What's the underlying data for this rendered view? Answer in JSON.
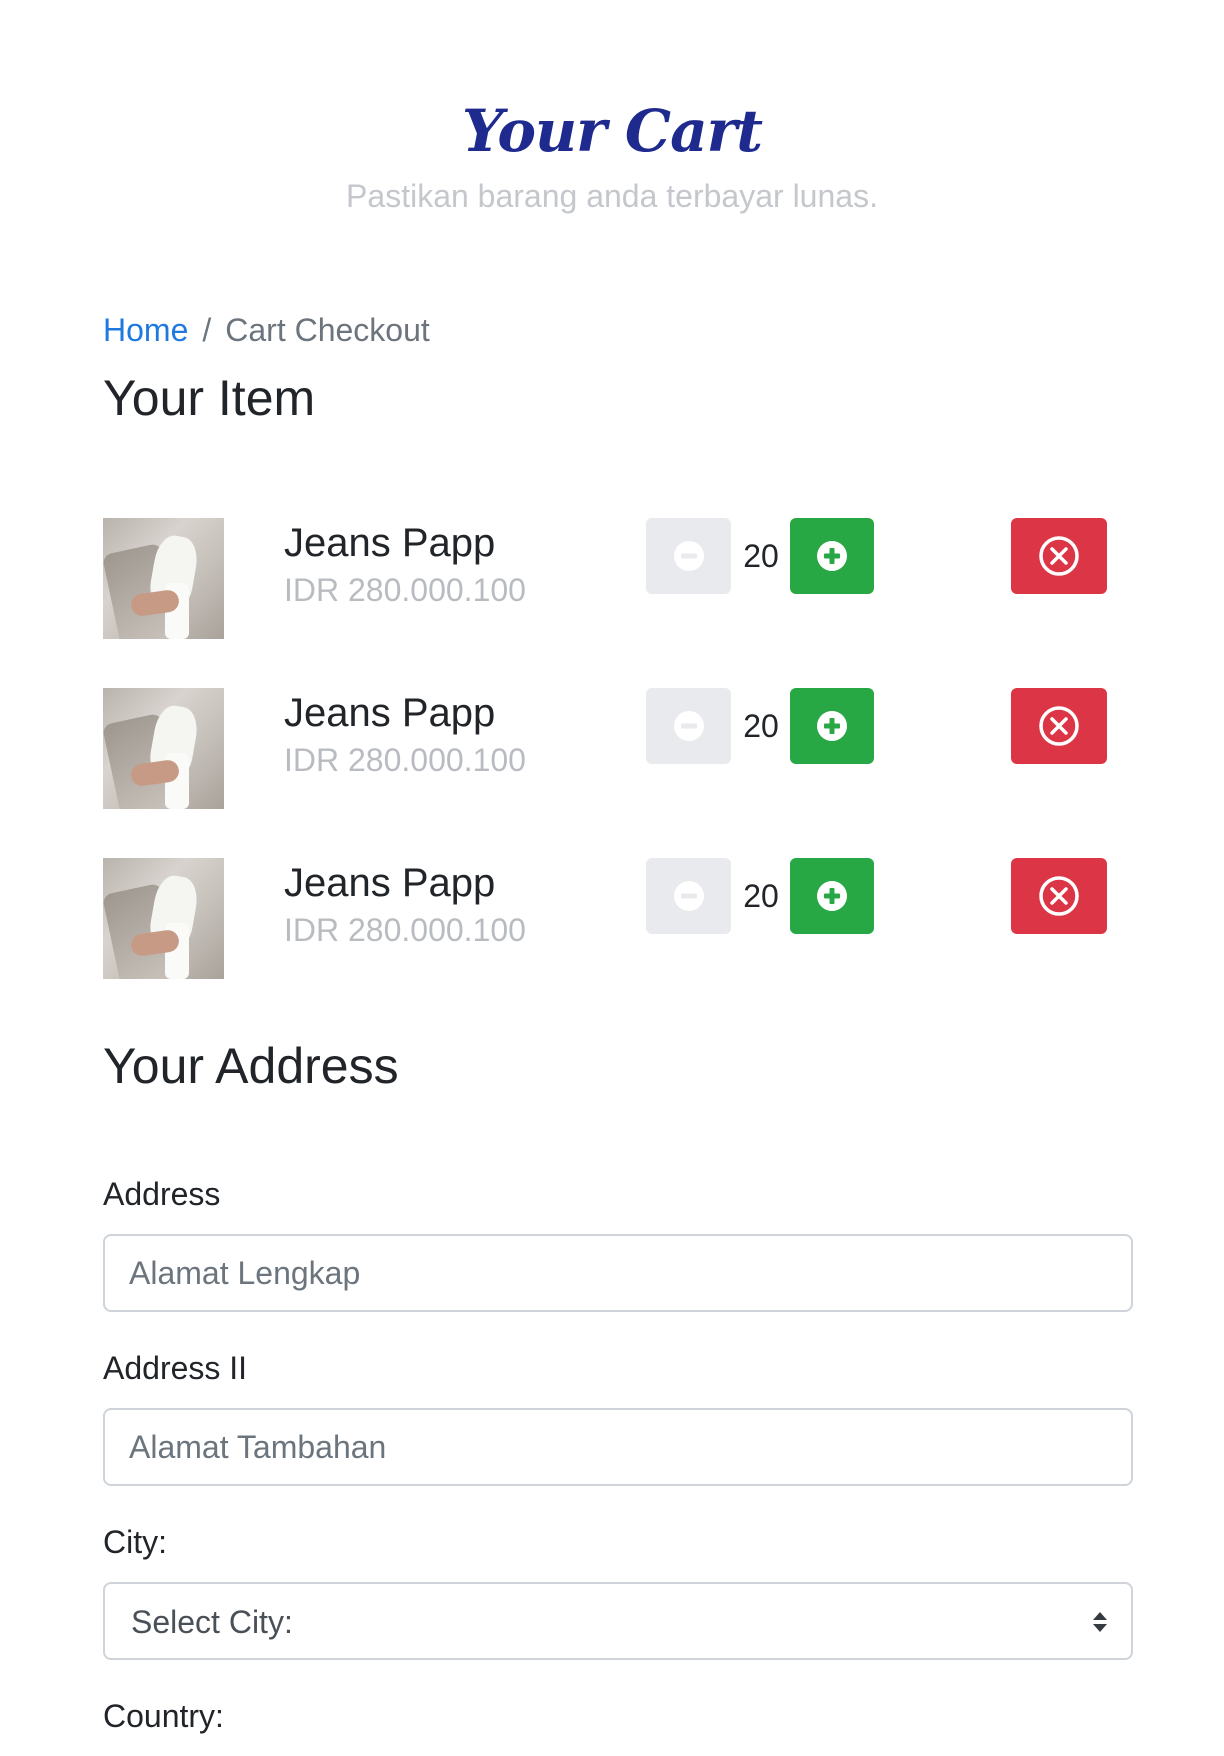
{
  "header": {
    "title": "Your Cart",
    "subtitle": "Pastikan barang anda terbayar lunas."
  },
  "breadcrumb": {
    "home": "Home",
    "separator": "/",
    "current": "Cart Checkout"
  },
  "items_section": {
    "title": "Your Item",
    "items": [
      {
        "name": "Jeans Papp",
        "price": "IDR 280.000.100",
        "quantity": "20"
      },
      {
        "name": "Jeans Papp",
        "price": "IDR 280.000.100",
        "quantity": "20"
      },
      {
        "name": "Jeans Papp",
        "price": "IDR 280.000.100",
        "quantity": "20"
      }
    ],
    "icons": {
      "decrease": "minus-circle-icon",
      "increase": "plus-circle-icon",
      "remove": "x-circle-icon"
    }
  },
  "address_section": {
    "title": "Your Address",
    "address_label": "Address",
    "address_placeholder": "Alamat Lengkap",
    "address2_label": "Address II",
    "address2_placeholder": "Alamat Tambahan",
    "city_label": "City:",
    "city_value": "Select City:",
    "country_label": "Country:"
  },
  "colors": {
    "title": "#1f2a8f",
    "link": "#1f7ae0",
    "plus_button": "#28a745",
    "remove_button": "#dc3545",
    "minus_button": "#e9eaed"
  }
}
